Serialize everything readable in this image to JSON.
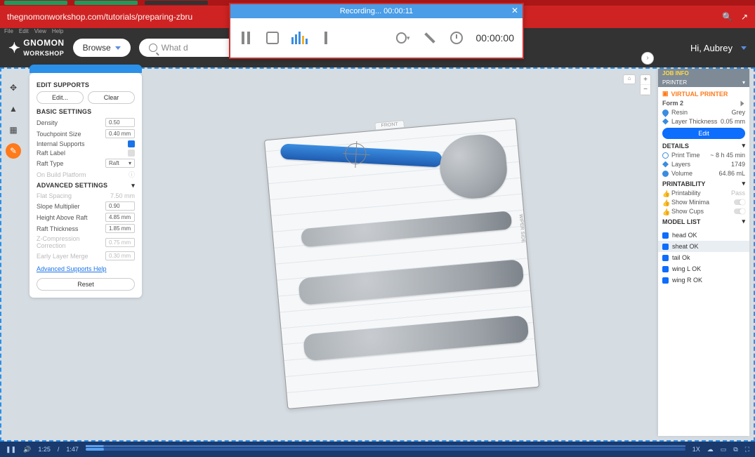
{
  "browser": {
    "url": "thegnomonworkshop.com/tutorials/preparing-zbru",
    "hi": "Hi, Aubrey",
    "browse": "Browse",
    "search_placeholder": "What d"
  },
  "recorder": {
    "title": "Recording... 00:00:11",
    "clock": "00:00:00"
  },
  "micro_menu": [
    "File",
    "Edit",
    "View",
    "Help"
  ],
  "left": {
    "editSupports": "EDIT SUPPORTS",
    "editBtn": "Edit...",
    "clearBtn": "Clear",
    "basic": "BASIC SETTINGS",
    "density": {
      "label": "Density",
      "val": "0.50"
    },
    "touch": {
      "label": "Touchpoint Size",
      "val": "0.40 mm"
    },
    "internal": "Internal Supports",
    "raftLabel": "Raft Label",
    "raftType": {
      "label": "Raft Type",
      "val": "Raft"
    },
    "onBuild": "On Build Platform",
    "advanced": "ADVANCED SETTINGS",
    "flat": {
      "label": "Flat Spacing",
      "val": "7.50 mm"
    },
    "slope": {
      "label": "Slope Multiplier",
      "val": "0.90"
    },
    "height": {
      "label": "Height Above Raft",
      "val": "4.85 mm"
    },
    "raftT": {
      "label": "Raft Thickness",
      "val": "1.85 mm"
    },
    "zcomp": {
      "label": "Z-Compression Correction",
      "val": "0.75 mm"
    },
    "early": {
      "label": "Early Layer Merge",
      "val": "0.30 mm"
    },
    "help": "Advanced Supports Help",
    "reset": "Reset"
  },
  "right": {
    "jobinfo": "JOB INFO",
    "printerHead": "PRINTER",
    "virtual": "VIRTUAL PRINTER",
    "printerName": "Form 2",
    "resin": {
      "label": "Resin",
      "val": "Grey"
    },
    "layer": {
      "label": "Layer Thickness",
      "val": "0.05 mm"
    },
    "edit": "Edit",
    "details": "DETAILS",
    "printTime": {
      "label": "Print Time",
      "val": "~ 8 h 45 min"
    },
    "layers": {
      "label": "Layers",
      "val": "1749"
    },
    "volume": {
      "label": "Volume",
      "val": "64.86 mL"
    },
    "printability": "PRINTABILITY",
    "printab": {
      "label": "Printability",
      "val": "Pass"
    },
    "minima": "Show Minima",
    "cups": "Show Cups",
    "modelList": "MODEL LIST",
    "models": [
      "head OK",
      "sheat OK",
      "tail Ok",
      "wing L OK",
      "wing R OK"
    ]
  },
  "plate": {
    "front": "FRONT",
    "side": "WIPER SIDE"
  },
  "video": {
    "cur": "1:25",
    "dur": "1:47",
    "speed": "1X"
  }
}
